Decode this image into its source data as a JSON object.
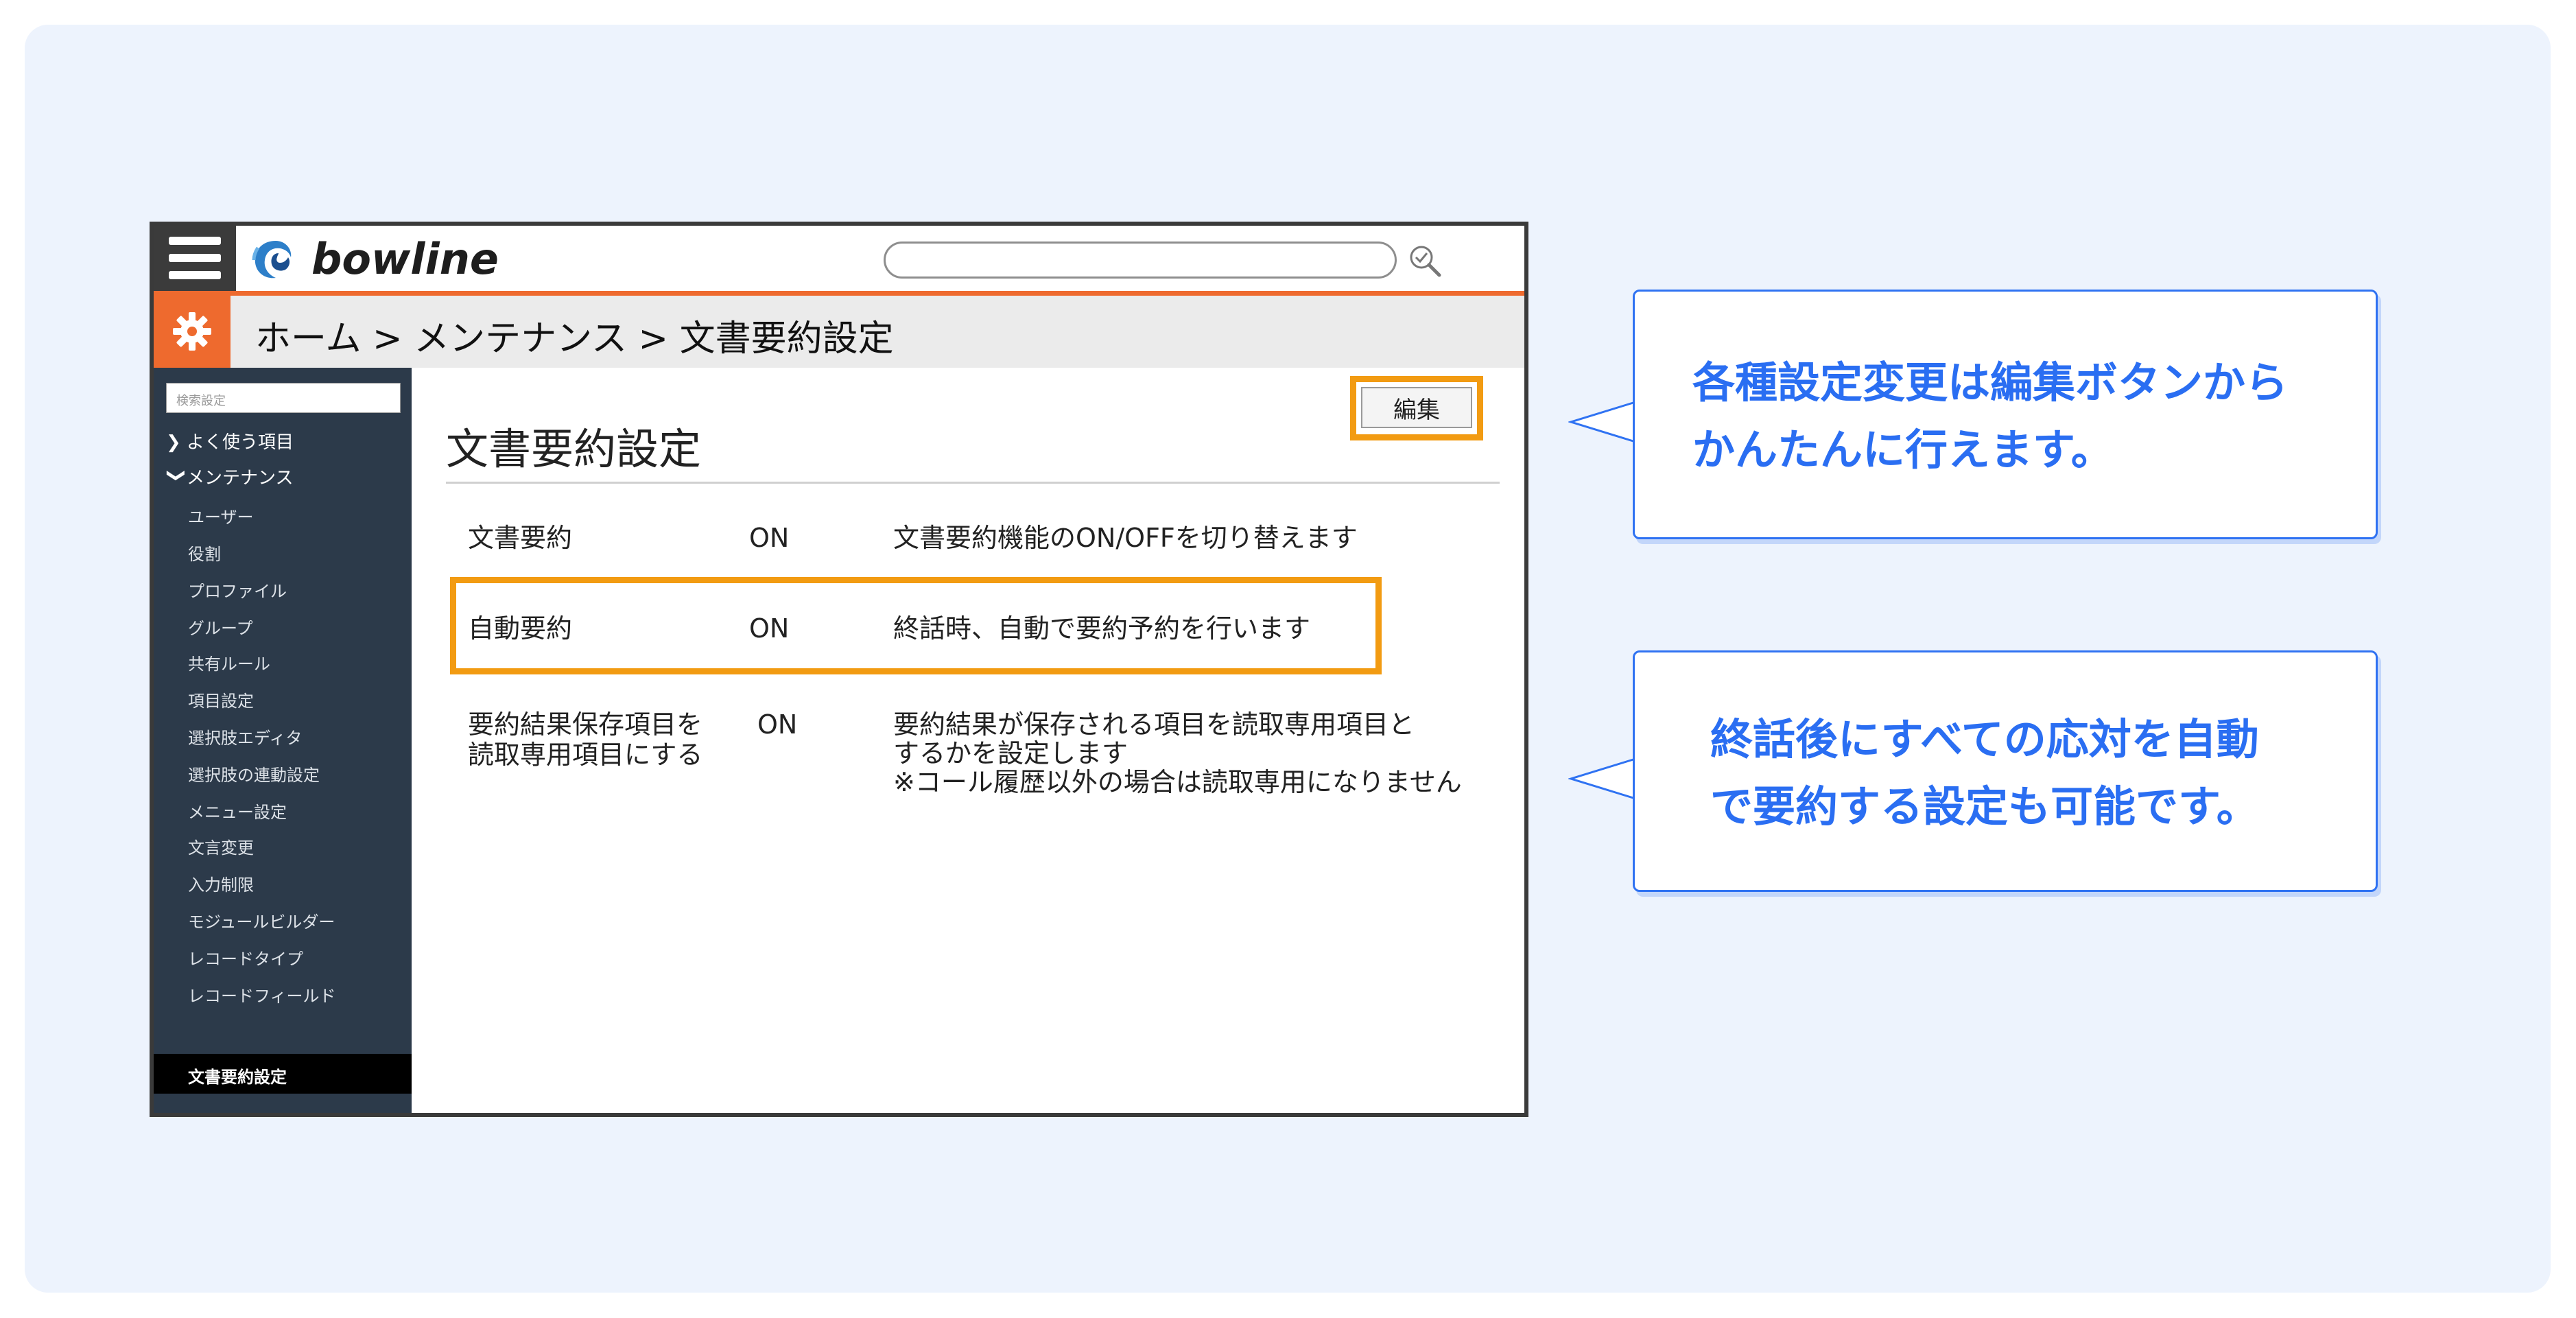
{
  "app": {
    "logo_text": "bowline",
    "search": {
      "value": ""
    }
  },
  "breadcrumb": {
    "text": "ホーム > メンテナンス > 文書要約設定"
  },
  "sidebar": {
    "search_placeholder": "検索設定",
    "groups": [
      {
        "label": "よく使う項目",
        "expanded": false,
        "caret": "❯"
      },
      {
        "label": "メンテナンス",
        "expanded": true,
        "caret": "❯"
      }
    ],
    "items": [
      {
        "label": "ユーザー"
      },
      {
        "label": "役割"
      },
      {
        "label": "プロファイル"
      },
      {
        "label": "グループ"
      },
      {
        "label": "共有ルール"
      },
      {
        "label": "項目設定"
      },
      {
        "label": "選択肢エディタ"
      },
      {
        "label": "選択肢の連動設定"
      },
      {
        "label": "メニュー設定"
      },
      {
        "label": "文言変更"
      },
      {
        "label": "入力制限"
      },
      {
        "label": "モジュールビルダー"
      },
      {
        "label": "レコードタイプ"
      },
      {
        "label": "レコードフィールド"
      }
    ],
    "active_item": "文書要約設定"
  },
  "main": {
    "title": "文書要約設定",
    "edit_button": "編集",
    "settings": [
      {
        "name": "文書要約",
        "value": "ON",
        "description": "文書要約機能のON/OFFを切り替えます"
      },
      {
        "name": "自動要約",
        "value": "ON",
        "description": "終話時、自動で要約予約を行います"
      },
      {
        "name_lines": [
          "要約結果保存項目を",
          "読取専用項目にする"
        ],
        "value": "ON",
        "description_lines": [
          "要約結果が保存される項目を読取専用項目と",
          "するかを設定します",
          "※コール履歴以外の場合は読取専用になりません"
        ]
      }
    ]
  },
  "callouts": [
    {
      "lines": [
        "各種設定変更は編集ボタンから",
        "かんたんに行えます。"
      ]
    },
    {
      "lines": [
        "終話後にすべての応対を自動",
        "で要約する設定も可能です。"
      ]
    }
  ],
  "colors": {
    "accent_orange": "#ee6a2e",
    "highlight": "#f29b12",
    "callout_blue": "#2a6ef2",
    "sidebar_bg": "#2c3a4a"
  }
}
